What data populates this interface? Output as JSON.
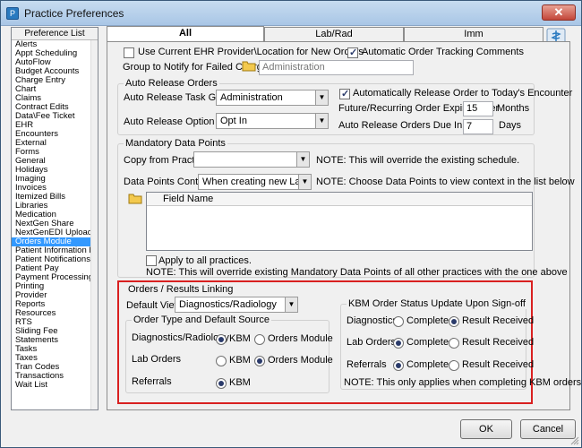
{
  "window": {
    "title": "Practice Preferences",
    "close_label": "✕",
    "app_icon": "P"
  },
  "pref_list": {
    "header": "Preference List",
    "items": [
      "Alerts",
      "Appt Scheduling",
      "AutoFlow",
      "Budget Accounts",
      "Charge Entry",
      "Chart",
      "Claims",
      "Contract Edits",
      "Data\\Fee Ticket",
      "EHR",
      "Encounters",
      "External",
      "Forms",
      "General",
      "Holidays",
      "Imaging",
      "Invoices",
      "Itemized Bills",
      "Libraries",
      "Medication",
      "NextGen Share",
      "NextGenEDI Uploading",
      "Orders Module",
      "Patient Information Bar",
      "Patient Notifications",
      "Patient Pay",
      "Payment Processing",
      "Printing",
      "Provider",
      "Reports",
      "Resources",
      "RTS",
      "Sliding Fee",
      "Statements",
      "Tasks",
      "Taxes",
      "Tran Codes",
      "Transactions",
      "Wait List"
    ],
    "selected": "Orders Module"
  },
  "tabs": [
    "All",
    "Lab/Rad",
    "Imm"
  ],
  "top": {
    "use_current_label": "Use Current EHR Provider\\Location for New Orders",
    "auto_tracking_label": "Automatic Order Tracking Comments",
    "group_notify_label": "Group to Notify for Failed Charges",
    "group_notify_value": "Administration"
  },
  "auto_release": {
    "legend": "Auto Release Orders",
    "task_group_label": "Auto Release Task Group",
    "task_group_value": "Administration",
    "option_label": "Auto Release Option",
    "option_value": "Opt In",
    "auto_release_today_label": "Automatically Release Order to Today's Encounter",
    "future_expires_label": "Future/Recurring Order Expires After",
    "future_expires_value": "15",
    "future_expires_unit": "Months",
    "due_in_label": "Auto Release Orders Due In",
    "due_in_value": "7",
    "due_in_unit": "Days"
  },
  "mandatory": {
    "legend": "Mandatory Data Points",
    "copy_label": "Copy from Practice",
    "copy_value": "",
    "copy_note": "NOTE: This will override the existing schedule.",
    "context_label": "Data Points Context",
    "context_value": "When creating new Lab order",
    "context_note": "NOTE: Choose Data Points to view context in the list below",
    "grid_column": "Field Name",
    "apply_all_label": "Apply to all practices.",
    "apply_all_note": "NOTE: This will override existing Mandatory Data Points of all other practices with the one above"
  },
  "linking": {
    "legend": "Orders / Results Linking",
    "default_view_label": "Default View",
    "default_view_value": "Diagnostics/Radiology",
    "order_type_legend": "Order Type and Default Source",
    "rows": [
      {
        "label": "Diagnostics/Radiology",
        "opt1": "KBM",
        "opt2": "Orders Module",
        "selected": 1
      },
      {
        "label": "Lab Orders",
        "opt1": "KBM",
        "opt2": "Orders Module",
        "selected": 2
      },
      {
        "label": "Referrals",
        "opt1": "KBM",
        "selected": 1
      }
    ],
    "kbm_legend": "KBM Order Status Update Upon Sign-off",
    "kbm_rows": [
      {
        "label": "Diagnostics",
        "opt1": "Completed",
        "opt2": "Result Received",
        "selected": 2
      },
      {
        "label": "Lab Orders",
        "opt1": "Completed",
        "opt2": "Result Received",
        "selected": 1
      },
      {
        "label": "Referrals",
        "opt1": "Completed",
        "opt2": "Result Received",
        "selected": 1
      }
    ],
    "kbm_note": "NOTE: This only applies when completing KBM orders"
  },
  "buttons": {
    "ok": "OK",
    "cancel": "Cancel"
  }
}
